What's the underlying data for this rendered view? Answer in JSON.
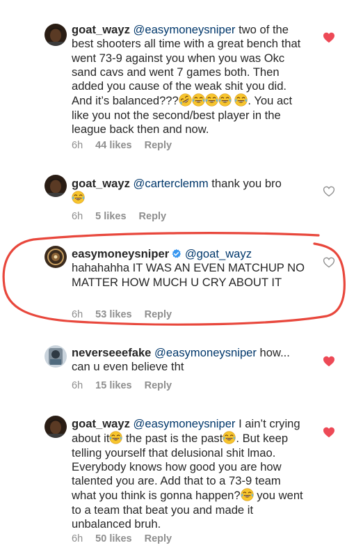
{
  "colors": {
    "liked_heart": "#ed4956",
    "mention": "#00376b",
    "meta": "#8e8e8e",
    "annotation": "#e8473c",
    "verified": "#3897f0"
  },
  "comments": [
    {
      "username": "goat_wayz",
      "mention": "@easymoneysniper",
      "text_a": " two of the best shooters all time with a great bench that went 73-9 against you when you was Okc sand cavs and went 7 games both. Then added you cause of the weak shit you did. And it’s balanced???",
      "text_b": ". You act like you not the second/best player in the league back then and now.",
      "time": "6h",
      "likes": "44 likes",
      "reply": "Reply",
      "liked": true
    },
    {
      "username": "goat_wayz",
      "mention": "@carterclemm",
      "text_a": " thank you bro",
      "time": "6h",
      "likes": "5 likes",
      "reply": "Reply",
      "liked": false
    },
    {
      "username": "easymoneysniper",
      "verified": true,
      "mention": "@goat_wayz",
      "text_a": "hahahahha IT WAS AN EVEN MATCHUP NO MATTER HOW MUCH U CRY ABOUT IT",
      "time": "6h",
      "likes": "53 likes",
      "reply": "Reply",
      "liked": false
    },
    {
      "username": "neverseeefake",
      "mention": "@easymoneysniper",
      "text_a": " how... can u even believe tht",
      "time": "6h",
      "likes": "15 likes",
      "reply": "Reply",
      "liked": true
    },
    {
      "username": "goat_wayz",
      "mention": "@easymoneysniper",
      "text_a": " I ain’t crying about it",
      "text_b": " the past is the past",
      "text_c": ". But keep telling yourself that delusional shit lmao. Everybody knows how good you are how talented you are. Add that to a 73-9 team what you think is gonna happen?",
      "text_d": " you went to a team that beat you and made it unbalanced bruh.",
      "time": "6h",
      "likes": "50 likes",
      "reply": "Reply",
      "liked": true
    }
  ],
  "icons": {
    "laugh_cry": "face-with-tears-of-joy-icon",
    "rofl": "rolling-on-floor-laughing-icon",
    "heart_filled": "heart-filled-icon",
    "heart_outline": "heart-outline-icon",
    "verified": "verified-badge-icon"
  }
}
